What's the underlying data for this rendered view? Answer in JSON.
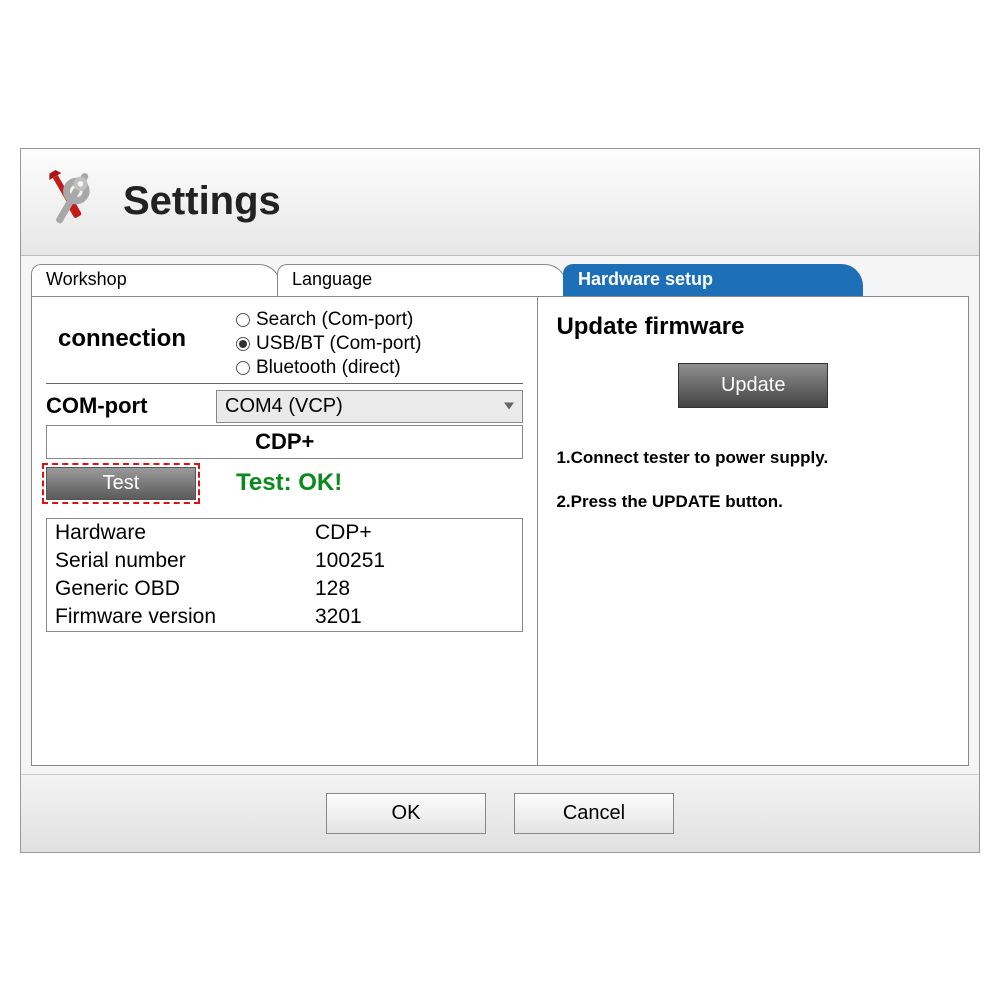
{
  "title": "Settings",
  "tabs": {
    "workshop": "Workshop",
    "language": "Language",
    "hardware": "Hardware setup"
  },
  "connection": {
    "label": "connection",
    "options": {
      "search": "Search (Com-port)",
      "usbbt": "USB/BT (Com-port)",
      "bluetooth": "Bluetooth (direct)"
    },
    "selected": "usbbt"
  },
  "comport": {
    "label": "COM-port",
    "value": "COM4 (VCP)"
  },
  "device_name": "CDP+",
  "test": {
    "button": "Test",
    "result": "Test: OK!"
  },
  "info": {
    "rows": [
      {
        "label": "Hardware",
        "value": "CDP+"
      },
      {
        "label": "Serial number",
        "value": "100251"
      },
      {
        "label": "Generic OBD",
        "value": "128"
      },
      {
        "label": "Firmware version",
        "value": "3201"
      }
    ]
  },
  "firmware": {
    "title": "Update firmware",
    "button": "Update",
    "step1": "1.Connect tester to power supply.",
    "step2": "2.Press the UPDATE button."
  },
  "footer": {
    "ok": "OK",
    "cancel": "Cancel"
  }
}
